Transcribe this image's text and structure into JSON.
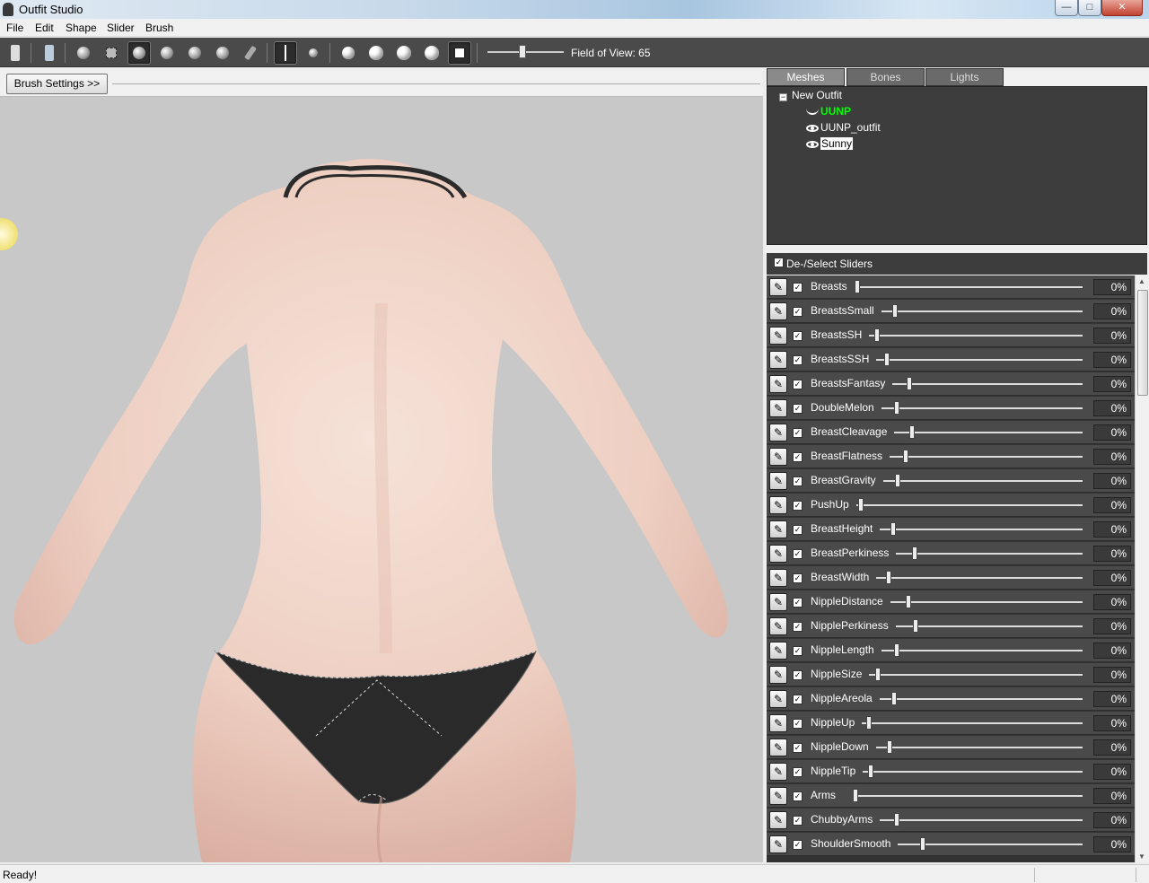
{
  "window": {
    "title": "Outfit Studio"
  },
  "menubar": [
    "File",
    "Edit",
    "Shape",
    "Slider",
    "Brush"
  ],
  "toolbar": {
    "icons": [
      "select-outfit-icon",
      "select-reference-icon",
      "select-icon",
      "mask-brush-icon",
      "inflate-brush-icon",
      "deflate-brush-icon",
      "move-brush-icon",
      "smooth-brush-icon",
      "weight-brush-icon",
      "xmirror-icon",
      "connected-only-icon",
      "brush-size-small-icon",
      "brush-size-medium-icon",
      "brush-size-large-icon",
      "brush-size-xlarge-icon",
      "wireframe-icon"
    ],
    "fov_label": "Field of View: 65",
    "fov_value": 65
  },
  "brush_settings_label": "Brush Settings >>",
  "tabs": [
    "Meshes",
    "Bones",
    "Lights"
  ],
  "active_tab": "Meshes",
  "tree": {
    "root": "New Outfit",
    "items": [
      {
        "label": "UUNP",
        "color": "#00ff00",
        "icon": "eye-closed-icon"
      },
      {
        "label": "UUNP_outfit",
        "color": "#ffffff",
        "icon": "eye-icon"
      },
      {
        "label": "Sunny",
        "color": "#ffffff",
        "icon": "eye-icon",
        "selected": true
      }
    ]
  },
  "sliders_header": "De-/Select Sliders",
  "sliders": [
    {
      "name": "Breasts",
      "value": "0%",
      "pos": 0.0
    },
    {
      "name": "BreastsSmall",
      "value": "0%",
      "pos": 0.12
    },
    {
      "name": "BreastsSH",
      "value": "0%",
      "pos": 0.06
    },
    {
      "name": "BreastsSSH",
      "value": "0%",
      "pos": 0.09
    },
    {
      "name": "BreastsFantasy",
      "value": "0%",
      "pos": 0.16
    },
    {
      "name": "DoubleMelon",
      "value": "0%",
      "pos": 0.14
    },
    {
      "name": "BreastCleavage",
      "value": "0%",
      "pos": 0.17
    },
    {
      "name": "BreastFlatness",
      "value": "0%",
      "pos": 0.15
    },
    {
      "name": "BreastGravity",
      "value": "0%",
      "pos": 0.13
    },
    {
      "name": "PushUp",
      "value": "0%",
      "pos": 0.02
    },
    {
      "name": "BreastHeight",
      "value": "0%",
      "pos": 0.12
    },
    {
      "name": "BreastPerkiness",
      "value": "0%",
      "pos": 0.18
    },
    {
      "name": "BreastWidth",
      "value": "0%",
      "pos": 0.11
    },
    {
      "name": "NippleDistance",
      "value": "0%",
      "pos": 0.17
    },
    {
      "name": "NipplePerkiness",
      "value": "0%",
      "pos": 0.19
    },
    {
      "name": "NippleLength",
      "value": "0%",
      "pos": 0.14
    },
    {
      "name": "NippleSize",
      "value": "0%",
      "pos": 0.07
    },
    {
      "name": "NippleAreola",
      "value": "0%",
      "pos": 0.13
    },
    {
      "name": "NippleUp",
      "value": "0%",
      "pos": 0.05
    },
    {
      "name": "NippleDown",
      "value": "0%",
      "pos": 0.12
    },
    {
      "name": "NippleTip",
      "value": "0%",
      "pos": 0.06
    },
    {
      "name": "Arms",
      "value": "0%",
      "pos": 0.0
    },
    {
      "name": "ChubbyArms",
      "value": "0%",
      "pos": 0.16
    },
    {
      "name": "ShoulderSmooth",
      "value": "0%",
      "pos": 0.25
    }
  ],
  "status": "Ready!"
}
